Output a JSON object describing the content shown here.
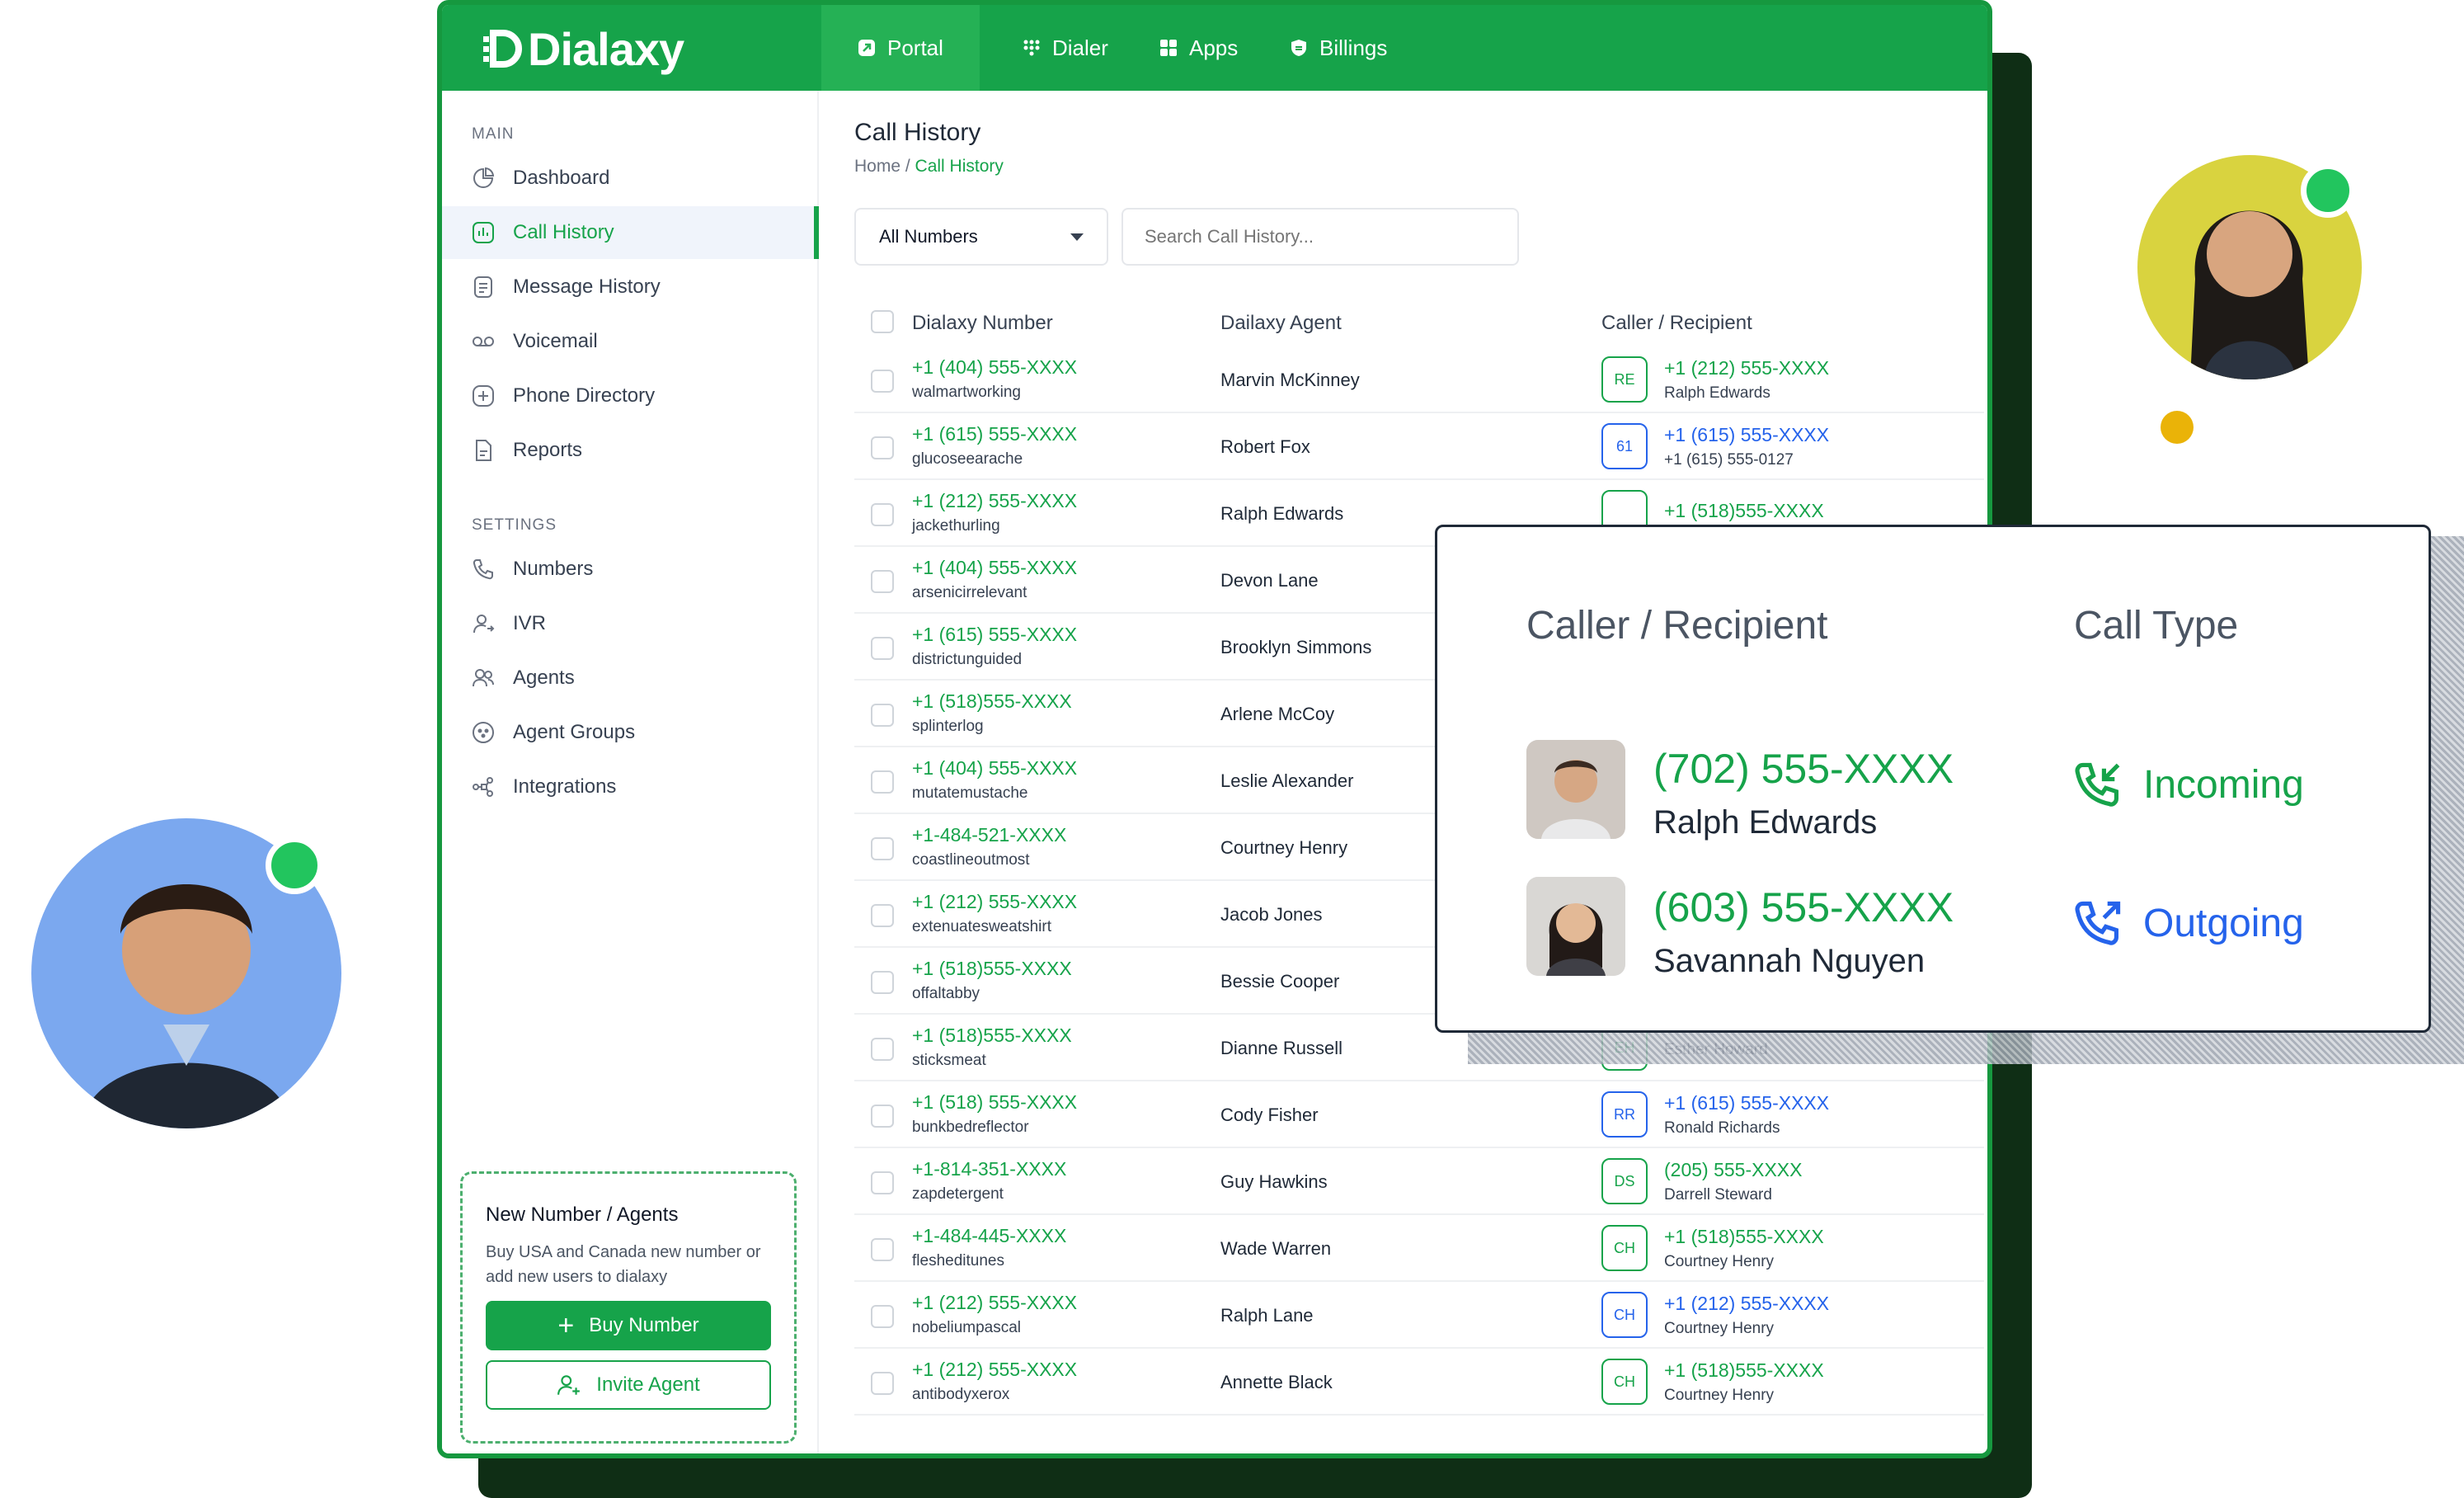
{
  "brand": {
    "name": "Dialaxy",
    "accent": "#16a34a",
    "dark": "#0f2e15",
    "link_blue": "#2563eb"
  },
  "topnav": [
    {
      "label": "Portal",
      "icon": "portal-icon",
      "active": true
    },
    {
      "label": "Dialer",
      "icon": "dialpad-icon",
      "active": false
    },
    {
      "label": "Apps",
      "icon": "grid-icon",
      "active": false
    },
    {
      "label": "Billings",
      "icon": "shield-icon",
      "active": false
    }
  ],
  "sidebar": {
    "main_title": "MAIN",
    "main_items": [
      {
        "label": "Dashboard",
        "icon": "pie-chart-icon",
        "active": false
      },
      {
        "label": "Call History",
        "icon": "bar-chart-icon",
        "active": true
      },
      {
        "label": "Message History",
        "icon": "document-icon",
        "active": false
      },
      {
        "label": "Voicemail",
        "icon": "voicemail-icon",
        "active": false
      },
      {
        "label": "Phone Directory",
        "icon": "plus-square-icon",
        "active": false
      },
      {
        "label": "Reports",
        "icon": "report-icon",
        "active": false
      }
    ],
    "settings_title": "SETTINGS",
    "settings_items": [
      {
        "label": "Numbers",
        "icon": "phone-icon"
      },
      {
        "label": "IVR",
        "icon": "user-switch-icon"
      },
      {
        "label": "Agents",
        "icon": "users-icon"
      },
      {
        "label": "Agent Groups",
        "icon": "group-icon"
      },
      {
        "label": "Integrations",
        "icon": "share-icon"
      }
    ],
    "promo": {
      "title": "New Number / Agents",
      "text": "Buy USA and Canada new number or add new users to dialaxy",
      "buy_label": "Buy Number",
      "invite_label": "Invite Agent"
    }
  },
  "page": {
    "title": "Call History",
    "breadcrumb_home": "Home",
    "breadcrumb_sep": " / ",
    "breadcrumb_current": "Call History",
    "filter_selected": "All Numbers",
    "search_placeholder": "Search Call History..."
  },
  "table": {
    "columns": {
      "number": "Dialaxy Number",
      "agent": "Dailaxy Agent",
      "caller": "Caller / Recipient"
    },
    "rows": [
      {
        "number": "+1 (404) 555-XXXX",
        "sub": "walmartworking",
        "agent": "Marvin McKinney",
        "badge": "RE",
        "caller_num": "+1 (212) 555-XXXX",
        "caller_name": "Ralph Edwards",
        "color": "green"
      },
      {
        "number": "+1 (615) 555-XXXX",
        "sub": "glucoseearache",
        "agent": "Robert Fox",
        "badge": "61",
        "caller_num": "+1 (615) 555-XXXX",
        "caller_name": "+1 (615) 555-0127",
        "color": "blue"
      },
      {
        "number": "+1 (212) 555-XXXX",
        "sub": "jackethurling",
        "agent": "Ralph Edwards",
        "badge": "",
        "caller_num": "+1 (518)555-XXXX",
        "caller_name": "",
        "color": "green"
      },
      {
        "number": "+1 (404) 555-XXXX",
        "sub": "arsenicirrelevant",
        "agent": "Devon Lane",
        "badge": "",
        "caller_num": "",
        "caller_name": "",
        "color": "green"
      },
      {
        "number": "+1 (615) 555-XXXX",
        "sub": "districtunguided",
        "agent": "Brooklyn Simmons",
        "badge": "",
        "caller_num": "",
        "caller_name": "",
        "color": "green"
      },
      {
        "number": "+1 (518)555-XXXX",
        "sub": "splinterlog",
        "agent": "Arlene McCoy",
        "badge": "",
        "caller_num": "",
        "caller_name": "",
        "color": "green"
      },
      {
        "number": "+1 (404) 555-XXXX",
        "sub": "mutatemustache",
        "agent": "Leslie Alexander",
        "badge": "",
        "caller_num": "",
        "caller_name": "",
        "color": "green"
      },
      {
        "number": "+1-484-521-XXXX",
        "sub": "coastlineoutmost",
        "agent": "Courtney Henry",
        "badge": "",
        "caller_num": "",
        "caller_name": "",
        "color": "green"
      },
      {
        "number": "+1 (212) 555-XXXX",
        "sub": "extenuatesweatshirt",
        "agent": "Jacob Jones",
        "badge": "",
        "caller_num": "",
        "caller_name": "",
        "color": "green"
      },
      {
        "number": "+1 (518)555-XXXX",
        "sub": "offaltabby",
        "agent": "Bessie Cooper",
        "badge": "",
        "caller_num": "",
        "caller_name": "",
        "color": "green"
      },
      {
        "number": "+1 (518)555-XXXX",
        "sub": "sticksmeat",
        "agent": "Dianne Russell",
        "badge": "EH",
        "caller_num": "",
        "caller_name": "Esther Howard",
        "color": "green"
      },
      {
        "number": "+1 (518) 555-XXXX",
        "sub": "bunkbedreflector",
        "agent": "Cody Fisher",
        "badge": "RR",
        "caller_num": "+1 (615) 555-XXXX",
        "caller_name": "Ronald Richards",
        "color": "blue"
      },
      {
        "number": "+1-814-351-XXXX",
        "sub": "zapdetergent",
        "agent": "Guy Hawkins",
        "badge": "DS",
        "caller_num": "(205) 555-XXXX",
        "caller_name": "Darrell Steward",
        "color": "green"
      },
      {
        "number": "+1-484-445-XXXX",
        "sub": "flesheditunes",
        "agent": "Wade Warren",
        "badge": "CH",
        "caller_num": "+1 (518)555-XXXX",
        "caller_name": "Courtney Henry",
        "color": "green"
      },
      {
        "number": "+1 (212) 555-XXXX",
        "sub": "nobeliumpascal",
        "agent": "Ralph Lane",
        "badge": "CH",
        "caller_num": "+1 (212) 555-XXXX",
        "caller_name": "Courtney Henry",
        "color": "blue"
      },
      {
        "number": "+1 (212) 555-XXXX",
        "sub": "antibodyxerox",
        "agent": "Annette Black",
        "badge": "CH",
        "caller_num": "+1 (518)555-XXXX",
        "caller_name": "Courtney Henry",
        "color": "green"
      }
    ]
  },
  "popup": {
    "col_caller": "Caller / Recipient",
    "col_type": "Call Type",
    "entries": [
      {
        "number": "(702) 555-XXXX",
        "name": "Ralph Edwards",
        "type": "Incoming",
        "type_icon": "incoming-call-icon",
        "type_color": "#16a34a"
      },
      {
        "number": "(603) 555-XXXX",
        "name": "Savannah Nguyen",
        "type": "Outgoing",
        "type_icon": "outgoing-call-icon",
        "type_color": "#2563eb"
      }
    ]
  }
}
